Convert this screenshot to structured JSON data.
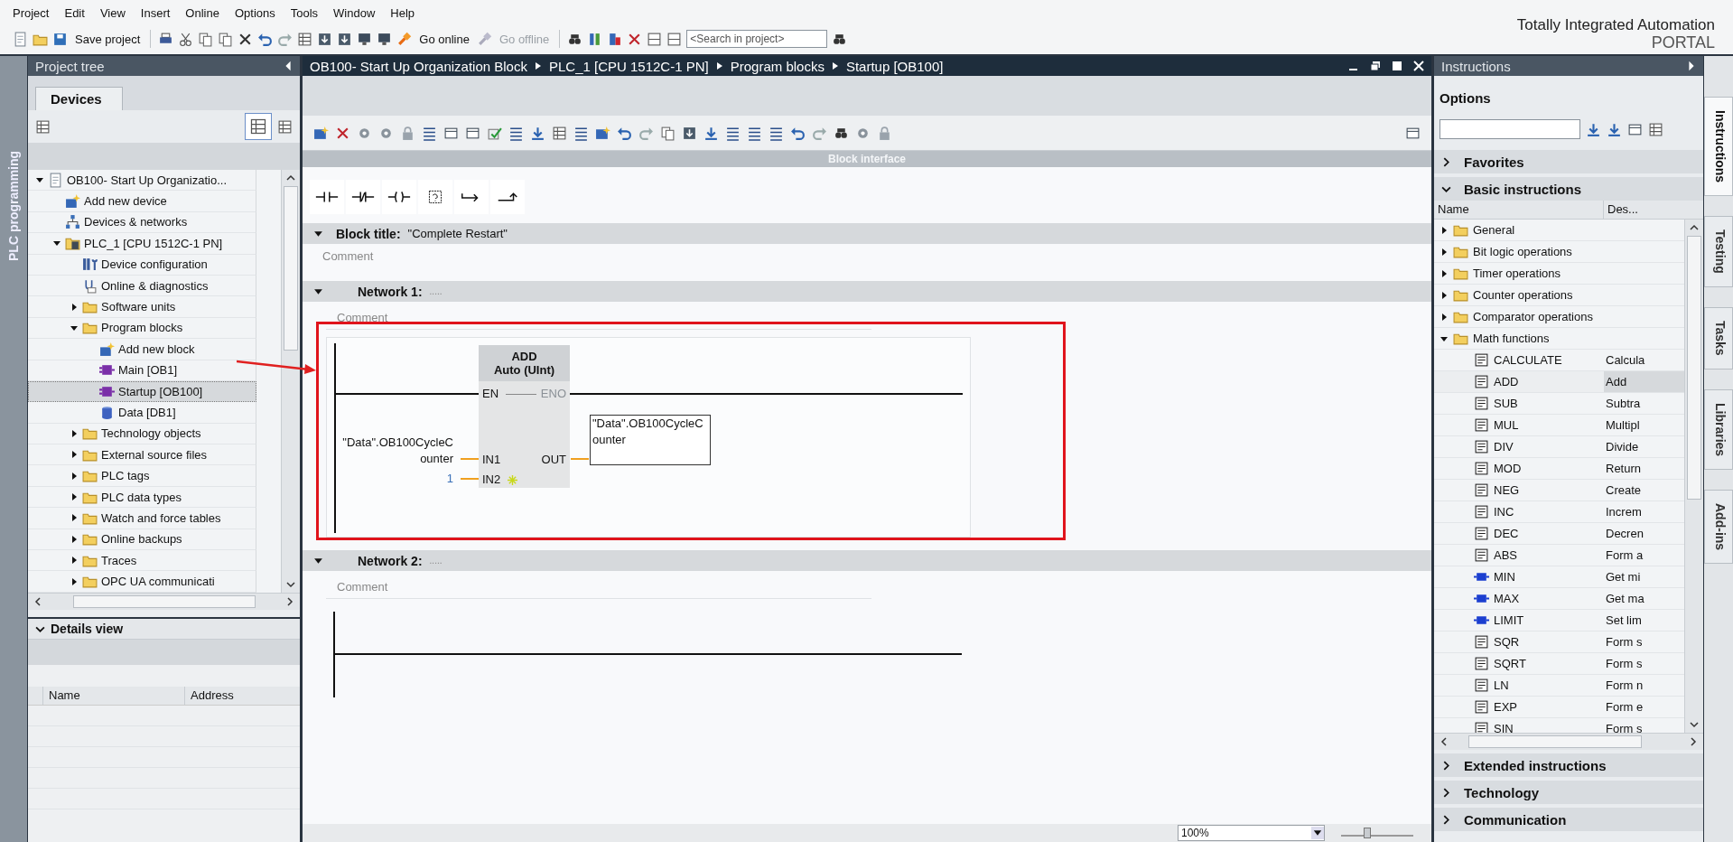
{
  "menu": [
    "Project",
    "Edit",
    "View",
    "Insert",
    "Online",
    "Options",
    "Tools",
    "Window",
    "Help"
  ],
  "toolbar": {
    "buttons": [
      {
        "label": "Save project",
        "disabled": false
      },
      {
        "label": "Go online",
        "disabled": false
      },
      {
        "label": "Go offline",
        "disabled": true
      }
    ],
    "search": {
      "placeholder": "<Search in project>"
    }
  },
  "brand": {
    "line_1": "Totally Integrated Automation",
    "line_2": "PORTAL"
  },
  "side_strip": "PLC programming",
  "project_tree": {
    "title": "Project tree",
    "tabs": [
      {
        "label": "Devices",
        "selected": true
      }
    ],
    "items": [
      {
        "label": "OB100- Start Up Organizatio...",
        "kind": "project",
        "expanded": true,
        "selected": false,
        "children": [
          {
            "label": "Add new device",
            "kind": "add",
            "selected": false
          },
          {
            "label": "Devices & networks",
            "kind": "network",
            "selected": false
          },
          {
            "label": "PLC_1 [CPU 1512C-1 PN]",
            "kind": "plc",
            "expanded": true,
            "selected": false,
            "children": [
              {
                "label": "Device configuration",
                "kind": "config",
                "selected": false
              },
              {
                "label": "Online & diagnostics",
                "kind": "diag",
                "selected": false
              },
              {
                "label": "Software units",
                "kind": "folder",
                "expanded": false,
                "selected": false
              },
              {
                "label": "Program blocks",
                "kind": "folder",
                "expanded": true,
                "selected": false,
                "children": [
                  {
                    "label": "Add new block",
                    "kind": "add",
                    "selected": false
                  },
                  {
                    "label": "Main [OB1]",
                    "kind": "block",
                    "selected": false
                  },
                  {
                    "label": "Startup [OB100]",
                    "kind": "block",
                    "selected": true
                  },
                  {
                    "label": "Data [DB1]",
                    "kind": "db",
                    "selected": false
                  }
                ]
              },
              {
                "label": "Technology objects",
                "kind": "folder",
                "expanded": false,
                "selected": false
              },
              {
                "label": "External source files",
                "kind": "folder",
                "expanded": false,
                "selected": false
              },
              {
                "label": "PLC tags",
                "kind": "folder",
                "expanded": false,
                "selected": false
              },
              {
                "label": "PLC data types",
                "kind": "folder",
                "expanded": false,
                "selected": false
              },
              {
                "label": "Watch and force tables",
                "kind": "folder",
                "expanded": false,
                "selected": false
              },
              {
                "label": "Online backups",
                "kind": "folder",
                "expanded": false,
                "selected": false
              },
              {
                "label": "Traces",
                "kind": "folder",
                "expanded": false,
                "selected": false
              },
              {
                "label": "OPC UA communicati",
                "kind": "folder",
                "expanded": false,
                "selected": false
              }
            ]
          }
        ]
      }
    ]
  },
  "details_view": {
    "title": "Details view",
    "expanded": true,
    "columns": [
      "Name",
      "Address"
    ]
  },
  "editor": {
    "breadcrumb": [
      "OB100- Start Up Organization Block",
      "PLC_1 [CPU 1512C-1 PN]",
      "Program blocks",
      "Startup [OB100]"
    ],
    "block_interface": "Block interface",
    "block_title": {
      "label": "Block title:",
      "value": "\"Complete Restart\"",
      "comment": "Comment",
      "expanded": true
    },
    "networks": [
      {
        "title": "Network 1:",
        "dots": ".....",
        "comment": "Comment",
        "expanded": true,
        "instruction": {
          "name": "ADD",
          "type": "Auto (UInt)",
          "en": "EN",
          "eno": "ENO",
          "eno_disabled": true,
          "inputs": [
            {
              "pin": "IN1",
              "operand": "\"Data\".OB100CycleCounter",
              "kind": "tag"
            },
            {
              "pin": "IN2",
              "operand": "1",
              "kind": "constant"
            }
          ],
          "output": {
            "pin": "OUT",
            "operand": "\"Data\".OB100CycleCounter"
          }
        }
      },
      {
        "title": "Network 2:",
        "dots": ".....",
        "comment": "Comment",
        "expanded": true
      }
    ],
    "zoom": "100%",
    "zoom_slider": {
      "level": 0.35
    }
  },
  "instructions": {
    "title": "Instructions",
    "options": "Options",
    "sections": [
      {
        "label": "Favorites",
        "expanded": false
      },
      {
        "label": "Basic instructions",
        "expanded": true,
        "columns": [
          "Name",
          "Des..."
        ],
        "items": [
          {
            "name": "General",
            "expanded": false,
            "selected": false
          },
          {
            "name": "Bit logic operations",
            "expanded": false,
            "selected": false
          },
          {
            "name": "Timer operations",
            "expanded": false,
            "selected": false
          },
          {
            "name": "Counter operations",
            "expanded": false,
            "selected": false
          },
          {
            "name": "Comparator operations",
            "expanded": false,
            "selected": false
          },
          {
            "name": "Math functions",
            "expanded": true,
            "selected": false,
            "children": [
              {
                "name": "CALCULATE",
                "description": "Calcula",
                "kind": "box",
                "selected": false
              },
              {
                "name": "ADD",
                "description": "Add",
                "kind": "box",
                "selected": true
              },
              {
                "name": "SUB",
                "description": "Subtra",
                "kind": "box",
                "selected": false
              },
              {
                "name": "MUL",
                "description": "Multipl",
                "kind": "box",
                "selected": false
              },
              {
                "name": "DIV",
                "description": "Divide",
                "kind": "box",
                "selected": false
              },
              {
                "name": "MOD",
                "description": "Return",
                "kind": "box",
                "selected": false
              },
              {
                "name": "NEG",
                "description": "Create",
                "kind": "box",
                "selected": false
              },
              {
                "name": "INC",
                "description": "Increm",
                "kind": "box",
                "selected": false
              },
              {
                "name": "DEC",
                "description": "Decren",
                "kind": "box",
                "selected": false
              },
              {
                "name": "ABS",
                "description": "Form a",
                "kind": "box",
                "selected": false
              },
              {
                "name": "MIN",
                "description": "Get mi",
                "kind": "block",
                "selected": false
              },
              {
                "name": "MAX",
                "description": "Get ma",
                "kind": "block",
                "selected": false
              },
              {
                "name": "LIMIT",
                "description": "Set lim",
                "kind": "block",
                "selected": false
              },
              {
                "name": "SQR",
                "description": "Form s",
                "kind": "box",
                "selected": false
              },
              {
                "name": "SQRT",
                "description": "Form s",
                "kind": "box",
                "selected": false
              },
              {
                "name": "LN",
                "description": "Form n",
                "kind": "box",
                "selected": false
              },
              {
                "name": "EXP",
                "description": "Form e",
                "kind": "box",
                "selected": false
              },
              {
                "name": "SIN",
                "description": "Form s",
                "kind": "box",
                "selected": false
              }
            ]
          }
        ]
      },
      {
        "label": "Extended instructions",
        "expanded": false
      },
      {
        "label": "Technology",
        "expanded": false
      },
      {
        "label": "Communication",
        "expanded": false
      }
    ]
  },
  "side_tabs": [
    {
      "label": "Instructions",
      "selected": true
    },
    {
      "label": "Testing",
      "selected": false
    },
    {
      "label": "Tasks",
      "selected": false
    },
    {
      "label": "Libraries",
      "selected": false
    },
    {
      "label": "Add-ins",
      "selected": false
    }
  ]
}
